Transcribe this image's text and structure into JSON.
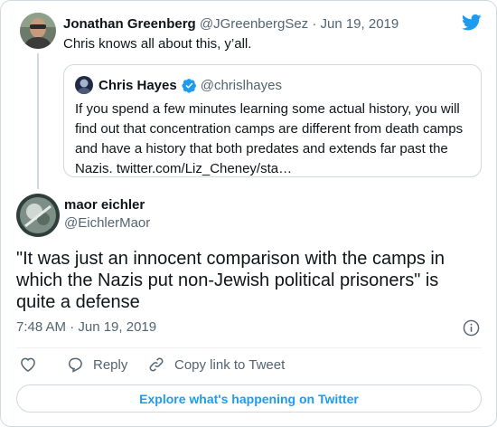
{
  "colors": {
    "accent": "#1d9bf0",
    "text": "#0f1419",
    "muted": "#536471",
    "border": "#cfd9de"
  },
  "parent_tweet": {
    "author_name": "Jonathan Greenberg",
    "meta": "@JGreenbergSez · Jun 19, 2019",
    "text": "Chris knows all about this, y’all.",
    "avatar_icon": "user-avatar-photo"
  },
  "quoted_tweet": {
    "author_name": "Chris Hayes",
    "handle": "@chrislhayes",
    "verified_icon": "verified-badge-icon",
    "text": "If you spend a few minutes learning some actual history, you will find out that concentration camps are different from death camps and have a history that both predates and extends far past the Nazis. twitter.com/Liz_Cheney/sta…"
  },
  "main_tweet": {
    "author_name": "maor eichler",
    "handle": "@EichlerMaor",
    "text": "\"It was just an innocent comparison with the camps in which the Nazis put non-Jewish political prisoners\" is quite a defense",
    "timestamp": "7:48 AM · Jun 19, 2019"
  },
  "actions": {
    "like_icon": "heart-icon",
    "reply_label": "Reply",
    "copy_link_label": "Copy link to Tweet"
  },
  "explore_label": "Explore what's happening on Twitter"
}
